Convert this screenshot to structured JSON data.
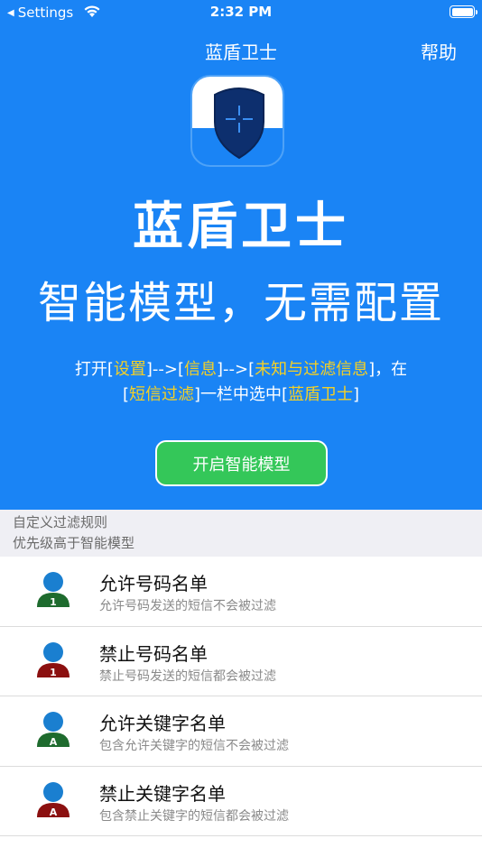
{
  "status_bar": {
    "back_label": "Settings",
    "time": "2:32 PM"
  },
  "nav": {
    "title": "蓝盾卫士",
    "help": "帮助"
  },
  "hero": {
    "brand": "蓝盾卫士",
    "slogan": "智能模型，无需配置",
    "instruction": {
      "p1": "打开[",
      "h1": "设置",
      "p2": "]-->[",
      "h2": "信息",
      "p3": "]-->[",
      "h3": "未知与过滤信息",
      "p4": "]，在",
      "p5": "[",
      "h4": "短信过滤",
      "p6": "]一栏中选中[",
      "h5": "蓝盾卫士",
      "p7": "]"
    },
    "enable_button": "开启智能模型"
  },
  "section": {
    "line1": "自定义过滤规则",
    "line2": "优先级高于智能模型"
  },
  "colors": {
    "hero_blue": "#1a84f5",
    "highlight": "#f5d024",
    "button_green": "#34c759",
    "allow_green": "#1e6b2e",
    "deny_red": "#8b1010",
    "avatar_head": "#1a7fd0"
  },
  "rules": [
    {
      "title": "允许号码名单",
      "subtitle": "允许号码发送的短信不会被过滤",
      "badge": "1",
      "icon": "allow-number-icon"
    },
    {
      "title": "禁止号码名单",
      "subtitle": "禁止号码发送的短信都会被过滤",
      "badge": "1",
      "icon": "block-number-icon"
    },
    {
      "title": "允许关键字名单",
      "subtitle": "包含允许关键字的短信不会被过滤",
      "badge": "A",
      "icon": "allow-keyword-icon"
    },
    {
      "title": "禁止关键字名单",
      "subtitle": "包含禁止关键字的短信都会被过滤",
      "badge": "A",
      "icon": "block-keyword-icon"
    }
  ]
}
